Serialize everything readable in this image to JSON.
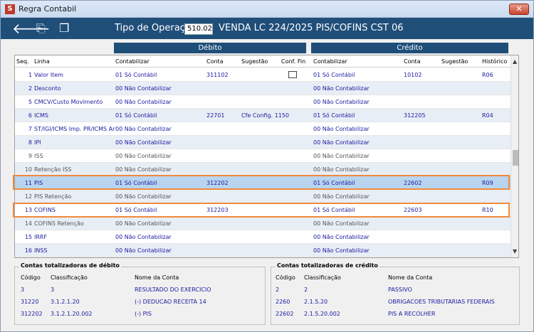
{
  "window": {
    "title": "Regra Contabil",
    "close_label": "✕"
  },
  "header": {
    "op_label": "Tipo de Operação",
    "op_code": "510.02",
    "op_desc": "VENDA LC 224/2025 PIS/COFINS CST 06"
  },
  "sections": {
    "debit": "Débito",
    "credit": "Crédito"
  },
  "columns": {
    "seq": "Seq.",
    "linha": "Linha",
    "contabilizar": "Contabilizar",
    "conta": "Conta",
    "sugestao": "Sugestão",
    "conf_fin": "Conf. Fin",
    "contabilizar_c": "Contabilizar",
    "conta_c": "Conta",
    "sugestao_c": "Sugestão",
    "historico": "Histórico"
  },
  "rows": [
    {
      "seq": "1",
      "linha": "Valor Item",
      "deb": "01 Só Contábil",
      "conta": "311102",
      "sug": "",
      "cred": "01 Só Contábil",
      "conta_c": "10102",
      "hist": "R06",
      "check": true
    },
    {
      "seq": "2",
      "linha": "Desconto",
      "deb": "00 Não Contabilizar",
      "conta": "",
      "sug": "",
      "cred": "00 Não Contabilizar",
      "conta_c": "",
      "hist": ""
    },
    {
      "seq": "5",
      "linha": "CMCV/Custo Movimento",
      "deb": "00 Não Contabilizar",
      "conta": "",
      "sug": "",
      "cred": "00 Não Contabilizar",
      "conta_c": "",
      "hist": ""
    },
    {
      "seq": "6",
      "linha": "ICMS",
      "deb": "01 Só Contábil",
      "conta": "22701",
      "sug": "Cfe Config. 1150",
      "cred": "01 Só Contábil",
      "conta_c": "312205",
      "hist": "R04"
    },
    {
      "seq": "7",
      "linha": "ST/IGI/ICMS Imp. PR/ICMS Ar",
      "deb": "00 Não Contabilizar",
      "conta": "",
      "sug": "",
      "cred": "00 Não Contabilizar",
      "conta_c": "",
      "hist": ""
    },
    {
      "seq": "8",
      "linha": "IPI",
      "deb": "00 Não Contabilizar",
      "conta": "",
      "sug": "",
      "cred": "00 Não Contabilizar",
      "conta_c": "",
      "hist": ""
    },
    {
      "seq": "9",
      "linha": "ISS",
      "deb": "00 Não Contabilizar",
      "conta": "",
      "sug": "",
      "cred": "00 Não Contabilizar",
      "conta_c": "",
      "hist": "",
      "gray": true
    },
    {
      "seq": "10",
      "linha": "Retenção ISS",
      "deb": "00 Não Contabilizar",
      "conta": "",
      "sug": "",
      "cred": "00 Não Contabilizar",
      "conta_c": "",
      "hist": "",
      "gray": true
    },
    {
      "seq": "11",
      "linha": "PIS",
      "deb": "01 Só Contábil",
      "conta": "312202",
      "sug": "",
      "cred": "01 Só Contábil",
      "conta_c": "22602",
      "hist": "R09",
      "selected": true
    },
    {
      "seq": "12",
      "linha": "PIS Retenção",
      "deb": "00 Não Contabilizar",
      "conta": "",
      "sug": "",
      "cred": "00 Não Contabilizar",
      "conta_c": "",
      "hist": "",
      "gray": true
    },
    {
      "seq": "13",
      "linha": "COFINS",
      "deb": "01 Só Contábil",
      "conta": "312203",
      "sug": "",
      "cred": "01 Só Contábil",
      "conta_c": "22603",
      "hist": "R10"
    },
    {
      "seq": "14",
      "linha": "COFINS Retenção",
      "deb": "00 Não Contabilizar",
      "conta": "",
      "sug": "",
      "cred": "00 Não Contabilizar",
      "conta_c": "",
      "hist": "",
      "gray": true
    },
    {
      "seq": "15",
      "linha": "IRRF",
      "deb": "00 Não Contabilizar",
      "conta": "",
      "sug": "",
      "cred": "00 Não Contabilizar",
      "conta_c": "",
      "hist": ""
    },
    {
      "seq": "16",
      "linha": "INSS",
      "deb": "00 Não Contabilizar",
      "conta": "",
      "sug": "",
      "cred": "00 Não Contabilizar",
      "conta_c": "",
      "hist": ""
    }
  ],
  "debit_panel": {
    "title": "Contas totalizadoras de débito",
    "h_codigo": "Código",
    "h_class": "Classificação",
    "h_nome": "Nome da Conta",
    "rows": [
      {
        "codigo": "3",
        "class": "3",
        "nome": "RESULTADO DO EXERCICIO"
      },
      {
        "codigo": "31220",
        "class": "3.1.2.1.20",
        "nome": "(-) DEDUCAO RECEITA 14"
      },
      {
        "codigo": "312202",
        "class": "3.1.2.1.20.002",
        "nome": "(-) PIS"
      }
    ]
  },
  "credit_panel": {
    "title": "Contas totalizadoras de crédito",
    "h_codigo": "Código",
    "h_class": "Classificação",
    "h_nome": "Nome da Conta",
    "rows": [
      {
        "codigo": "2",
        "class": "2",
        "nome": "PASSIVO"
      },
      {
        "codigo": "2260",
        "class": "2.1.5.20",
        "nome": "OBRIGACOES TRIBUTARIAS FEDERAIS"
      },
      {
        "codigo": "22602",
        "class": "2.1.5.20.002",
        "nome": "PIS A RECOLHER"
      }
    ]
  }
}
